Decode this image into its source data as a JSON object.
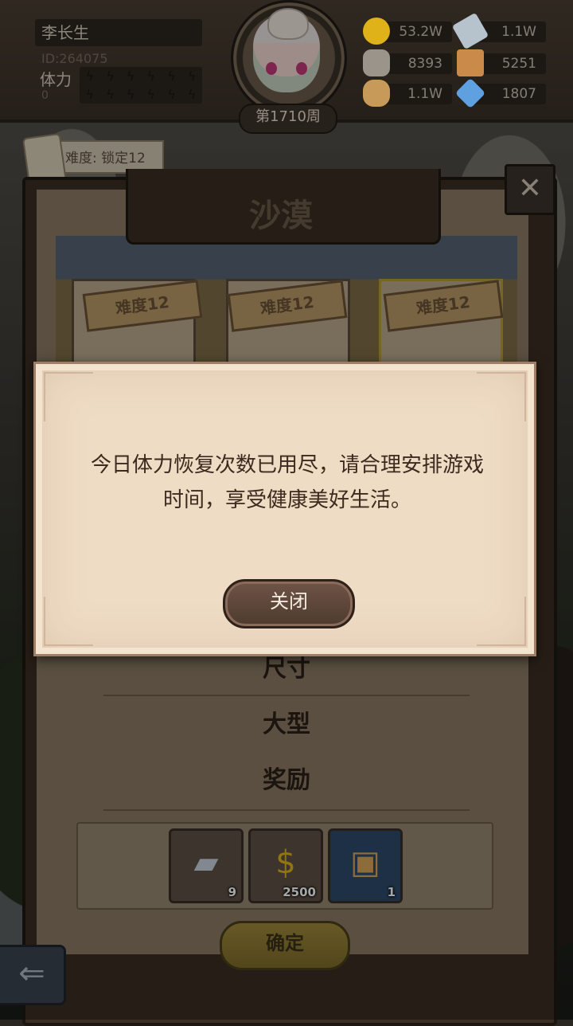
{
  "player": {
    "name": "李长生",
    "id": "ID:264075",
    "stamina_label": "体力",
    "stamina_value": "0"
  },
  "week": "第1710周",
  "resources": [
    {
      "name": "gold",
      "icon": "gold-coin-icon",
      "value": "53.2W",
      "color": "#e0b21a"
    },
    {
      "name": "iron",
      "icon": "iron-ingot-icon",
      "value": "1.1W",
      "color": "#b6c2cc"
    },
    {
      "name": "stone",
      "icon": "stone-icon",
      "value": "8393",
      "color": "#9a948a"
    },
    {
      "name": "leather",
      "icon": "leather-icon",
      "value": "5251",
      "color": "#c98a4a"
    },
    {
      "name": "wood",
      "icon": "wood-log-icon",
      "value": "1.1W",
      "color": "#c89a5a"
    },
    {
      "name": "crystal",
      "icon": "crystal-icon",
      "value": "1807",
      "color": "#5fa0e0"
    }
  ],
  "difficulty_tag": "难度: 锁定12",
  "panel": {
    "title": "沙漠",
    "cards": [
      {
        "label": "难度12"
      },
      {
        "label": "难度12"
      },
      {
        "label": "难度12"
      }
    ],
    "size_heading": "尺寸",
    "size_value": "大型",
    "reward_heading": "奖励",
    "rewards": [
      {
        "icon": "iron-ingot-icon",
        "count": "9"
      },
      {
        "icon": "gold-bag-icon",
        "count": "2500"
      },
      {
        "icon": "treasure-chest-icon",
        "count": "1"
      }
    ],
    "confirm_label": "确定"
  },
  "dialog": {
    "message": "今日体力恢复次数已用尽，请合理安排游戏时间，享受健康美好生活。",
    "close_label": "关闭"
  },
  "colors": {
    "dialog_bg": "#efdcc5",
    "dialog_text": "#3c2a1e",
    "button_brown": "#5e4538"
  }
}
